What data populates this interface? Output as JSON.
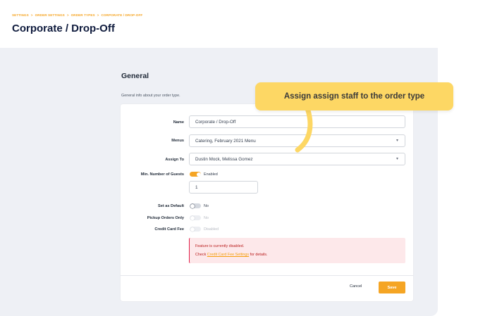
{
  "breadcrumb": {
    "items": [
      "SETTINGS",
      "ORDER SETTINGS",
      "ORDER TYPES",
      "CORPORATE / DROP-OFF"
    ],
    "separator": ">"
  },
  "page": {
    "title": "Corporate / Drop-Off"
  },
  "section": {
    "title": "General",
    "description": "General info about your order type."
  },
  "form": {
    "name": {
      "label": "Name",
      "value": "Corporate / Drop-Off"
    },
    "menus": {
      "label": "Menus",
      "value": "Catering, February 2021 Menu",
      "icon": "chevron-down-icon"
    },
    "assign_to": {
      "label": "Assign To",
      "value": "Dustin Mock, Melissa Gomez",
      "icon": "chevron-down-icon"
    },
    "min_guests": {
      "label": "Min. Number of Guests",
      "toggle_text": "Enabled",
      "enabled": true,
      "value": "1"
    },
    "set_default": {
      "label": "Set as Default",
      "toggle_text": "No",
      "enabled": false
    },
    "pickup_only": {
      "label": "Pickup Orders Only",
      "toggle_text": "No",
      "enabled": false
    },
    "credit_card_fee": {
      "label": "Credit Card Fee",
      "toggle_text": "Disabled",
      "enabled": false
    }
  },
  "alert": {
    "line1": "Feature is currently disabled.",
    "line2_prefix": "Check",
    "link": "Credit Card Fee Settings",
    "line2_suffix": "for details."
  },
  "actions": {
    "cancel": "Cancel",
    "save": "Save"
  },
  "tooltip": {
    "text": "Assign assign staff to the order type"
  },
  "colors": {
    "accent": "#f5a524",
    "tooltip": "#fdd764",
    "title": "#0f1b3d",
    "alert_bg": "#fde8ea",
    "alert_border": "#e11d48"
  }
}
